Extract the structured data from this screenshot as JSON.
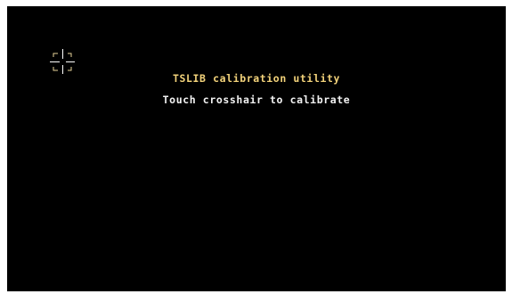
{
  "screen": {
    "title": "TSLIB calibration utility",
    "instruction": "Touch crosshair to calibrate"
  },
  "colors": {
    "background": "#000000",
    "title": "#f2d27a",
    "instruction": "#f2f2f2",
    "crosshair": "#ffffff"
  },
  "icons": {
    "target": "crosshair-icon"
  }
}
